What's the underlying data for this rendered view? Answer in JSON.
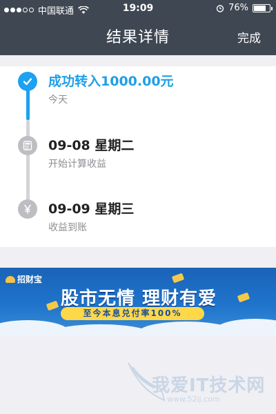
{
  "status_bar": {
    "carrier": "中国联通",
    "time": "19:09",
    "battery": "76%",
    "battery_level": 0.76
  },
  "nav": {
    "title": "结果详情",
    "done_label": "完成"
  },
  "timeline": [
    {
      "title": "成功转入1000.00元",
      "subtitle": "今天",
      "icon": "check-icon",
      "state": "done"
    },
    {
      "title": "09-08 星期二",
      "subtitle": "开始计算收益",
      "icon": "calculator-icon",
      "state": "pending"
    },
    {
      "title": "09-09 星期三",
      "subtitle": "收益到账",
      "icon": "yen-icon",
      "state": "pending"
    }
  ],
  "banner": {
    "brand": "招财宝",
    "headline": "股市无情 理财有爱",
    "slogan": "至今本息兑付率100%"
  },
  "watermark": {
    "text": "我爱IT技术网",
    "url": "www.52ij.com"
  },
  "colors": {
    "header": "#3f4753",
    "accent": "#1da1f2",
    "banner": "#1f74cc"
  }
}
